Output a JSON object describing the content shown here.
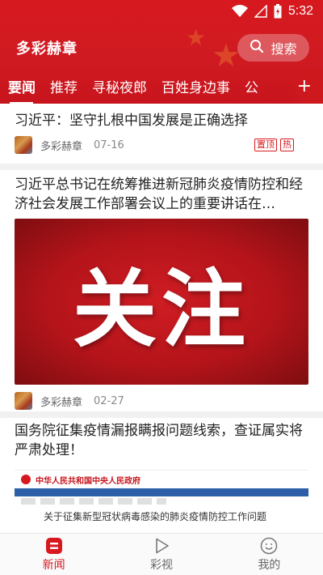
{
  "status_bar": {
    "time": "5:32"
  },
  "header": {
    "title": "多彩赫章",
    "search_label": "搜索"
  },
  "tabs": [
    "要闻",
    "推荐",
    "寻秘夜郎",
    "百姓身边事",
    "公"
  ],
  "tabs_more": "+",
  "articles": [
    {
      "title": "习近平：坚守扎根中国发展是正确选择",
      "source": "多彩赫章",
      "date": "07-16",
      "badges": [
        "置顶",
        "热"
      ]
    },
    {
      "title": "习近平总书记在统筹推进新冠肺炎疫情防控和经济社会发展工作部署会议上的重要讲话在…",
      "image_text": "关注",
      "source": "多彩赫章",
      "date": "02-27"
    },
    {
      "title": "国务院征集疫情漏报瞒报问题线索，查证属实将严肃处理！",
      "image_site": "中华人民共和国中央人民政府",
      "image_doc_title": "关于征集新型冠状病毒感染的肺炎疫情防控工作问题"
    }
  ],
  "bottom_nav": [
    {
      "label": "新闻",
      "icon": "news-icon"
    },
    {
      "label": "彩视",
      "icon": "play-icon"
    },
    {
      "label": "我的",
      "icon": "smile-icon"
    }
  ],
  "colors": {
    "brand": "#d7191f",
    "header": "#cf1a22",
    "divider": "#f1f1f1"
  }
}
